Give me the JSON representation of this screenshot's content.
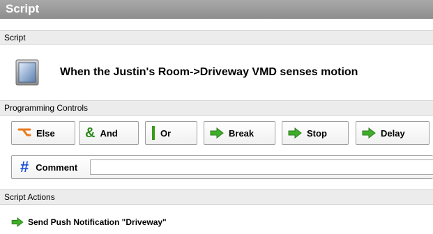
{
  "window": {
    "title": "Script"
  },
  "script_section": {
    "header": "Script",
    "trigger_icon": "monitor-icon",
    "trigger_text": "When the Justin's Room->Driveway VMD senses motion"
  },
  "controls_section": {
    "header": "Programming Controls",
    "buttons": [
      {
        "label": "Else",
        "icon": "else-branch-icon",
        "color": "#e87a1e"
      },
      {
        "label": "And",
        "icon": "ampersand-icon",
        "color": "#2e8b1e"
      },
      {
        "label": "Or",
        "icon": "bar-icon",
        "color": "#3a9a1a"
      },
      {
        "label": "Break",
        "icon": "arrow-right-icon",
        "color": "#3fae2a"
      },
      {
        "label": "Stop",
        "icon": "arrow-right-icon",
        "color": "#3fae2a"
      },
      {
        "label": "Delay",
        "icon": "arrow-right-icon",
        "color": "#3fae2a"
      }
    ],
    "comment": {
      "label": "Comment",
      "icon": "hash-icon",
      "value": "",
      "placeholder": ""
    }
  },
  "actions_section": {
    "header": "Script Actions",
    "actions": [
      {
        "icon": "arrow-right-icon",
        "text": "Send Push Notification \"Driveway\""
      }
    ]
  }
}
